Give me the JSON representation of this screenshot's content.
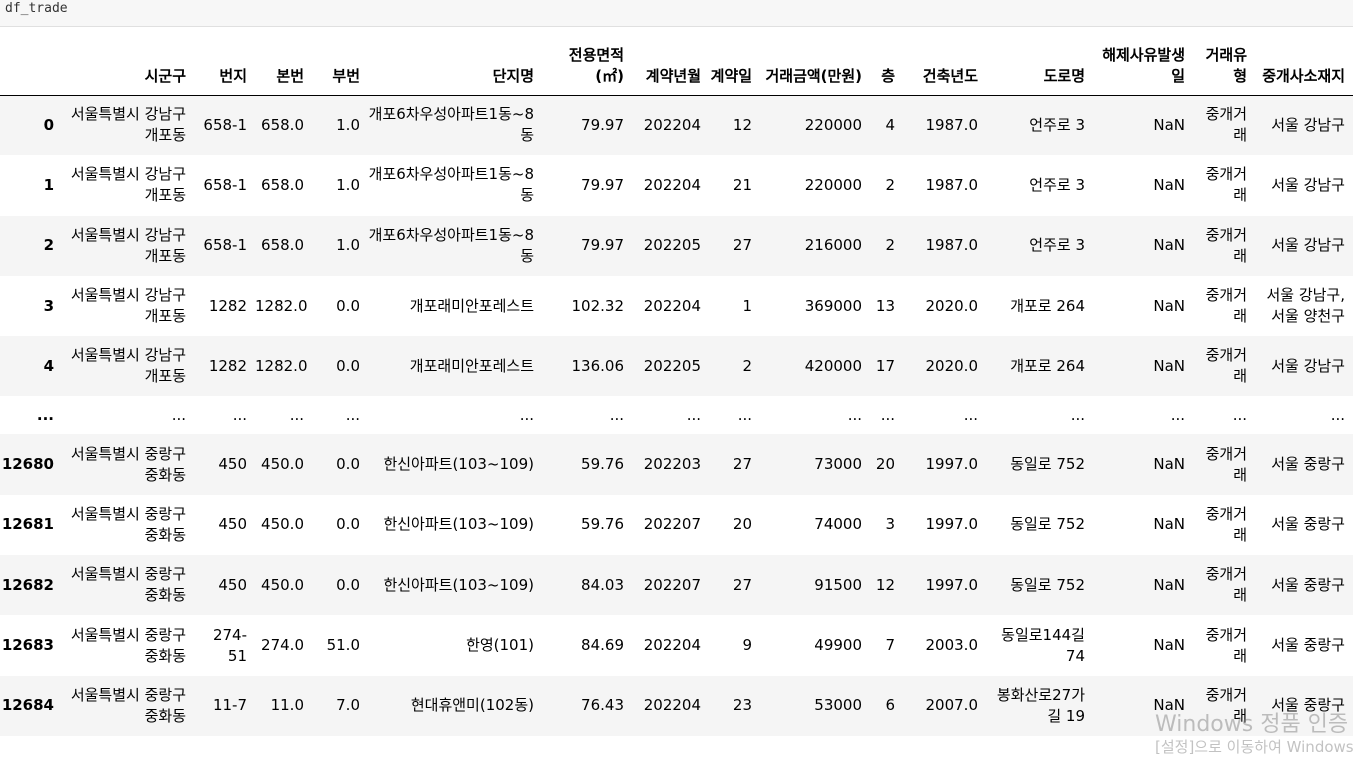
{
  "cell": {
    "code": "df_trade"
  },
  "table": {
    "columns": [
      "",
      "시군구",
      "번지",
      "본번",
      "부번",
      "단지명",
      "전용면적(㎡)",
      "계약년월",
      "계약일",
      "거래금액(만원)",
      "층",
      "건축년도",
      "도로명",
      "해제사유발생일",
      "거래유형",
      "중개사소재지"
    ],
    "rows": [
      {
        "idx": "0",
        "cells": [
          "서울특별시 강남구 개포동",
          "658-1",
          "658.0",
          "1.0",
          "개포6차우성아파트1동~8동",
          "79.97",
          "202204",
          "12",
          "220000",
          "4",
          "1987.0",
          "언주로 3",
          "NaN",
          "중개거래",
          "서울 강남구"
        ]
      },
      {
        "idx": "1",
        "cells": [
          "서울특별시 강남구 개포동",
          "658-1",
          "658.0",
          "1.0",
          "개포6차우성아파트1동~8동",
          "79.97",
          "202204",
          "21",
          "220000",
          "2",
          "1987.0",
          "언주로 3",
          "NaN",
          "중개거래",
          "서울 강남구"
        ]
      },
      {
        "idx": "2",
        "cells": [
          "서울특별시 강남구 개포동",
          "658-1",
          "658.0",
          "1.0",
          "개포6차우성아파트1동~8동",
          "79.97",
          "202205",
          "27",
          "216000",
          "2",
          "1987.0",
          "언주로 3",
          "NaN",
          "중개거래",
          "서울 강남구"
        ]
      },
      {
        "idx": "3",
        "cells": [
          "서울특별시 강남구 개포동",
          "1282",
          "1282.0",
          "0.0",
          "개포래미안포레스트",
          "102.32",
          "202204",
          "1",
          "369000",
          "13",
          "2020.0",
          "개포로 264",
          "NaN",
          "중개거래",
          "서울 강남구, 서울 양천구"
        ]
      },
      {
        "idx": "4",
        "cells": [
          "서울특별시 강남구 개포동",
          "1282",
          "1282.0",
          "0.0",
          "개포래미안포레스트",
          "136.06",
          "202205",
          "2",
          "420000",
          "17",
          "2020.0",
          "개포로 264",
          "NaN",
          "중개거래",
          "서울 강남구"
        ]
      },
      {
        "idx": "...",
        "ellipsis": true,
        "cells": [
          "...",
          "...",
          "...",
          "...",
          "...",
          "...",
          "...",
          "...",
          "...",
          "...",
          "...",
          "...",
          "...",
          "...",
          "..."
        ]
      },
      {
        "idx": "12680",
        "cells": [
          "서울특별시 중랑구 중화동",
          "450",
          "450.0",
          "0.0",
          "한신아파트(103~109)",
          "59.76",
          "202203",
          "27",
          "73000",
          "20",
          "1997.0",
          "동일로 752",
          "NaN",
          "중개거래",
          "서울 중랑구"
        ]
      },
      {
        "idx": "12681",
        "cells": [
          "서울특별시 중랑구 중화동",
          "450",
          "450.0",
          "0.0",
          "한신아파트(103~109)",
          "59.76",
          "202207",
          "20",
          "74000",
          "3",
          "1997.0",
          "동일로 752",
          "NaN",
          "중개거래",
          "서울 중랑구"
        ]
      },
      {
        "idx": "12682",
        "cells": [
          "서울특별시 중랑구 중화동",
          "450",
          "450.0",
          "0.0",
          "한신아파트(103~109)",
          "84.03",
          "202207",
          "27",
          "91500",
          "12",
          "1997.0",
          "동일로 752",
          "NaN",
          "중개거래",
          "서울 중랑구"
        ]
      },
      {
        "idx": "12683",
        "cells": [
          "서울특별시 중랑구 중화동",
          "274-51",
          "274.0",
          "51.0",
          "한영(101)",
          "84.69",
          "202204",
          "9",
          "49900",
          "7",
          "2003.0",
          "동일로144길 74",
          "NaN",
          "중개거래",
          "서울 중랑구"
        ]
      },
      {
        "idx": "12684",
        "cells": [
          "서울특별시 중랑구 중화동",
          "11-7",
          "11.0",
          "7.0",
          "현대휴앤미(102동)",
          "76.43",
          "202204",
          "23",
          "53000",
          "6",
          "2007.0",
          "봉화산로27가길 19",
          "NaN",
          "중개거래",
          "서울 중랑구"
        ]
      }
    ]
  },
  "watermark": {
    "line1": "Windows 정품 인증",
    "line2": "[설정]으로 이동하여 Windows를 정품 인증합니다."
  }
}
